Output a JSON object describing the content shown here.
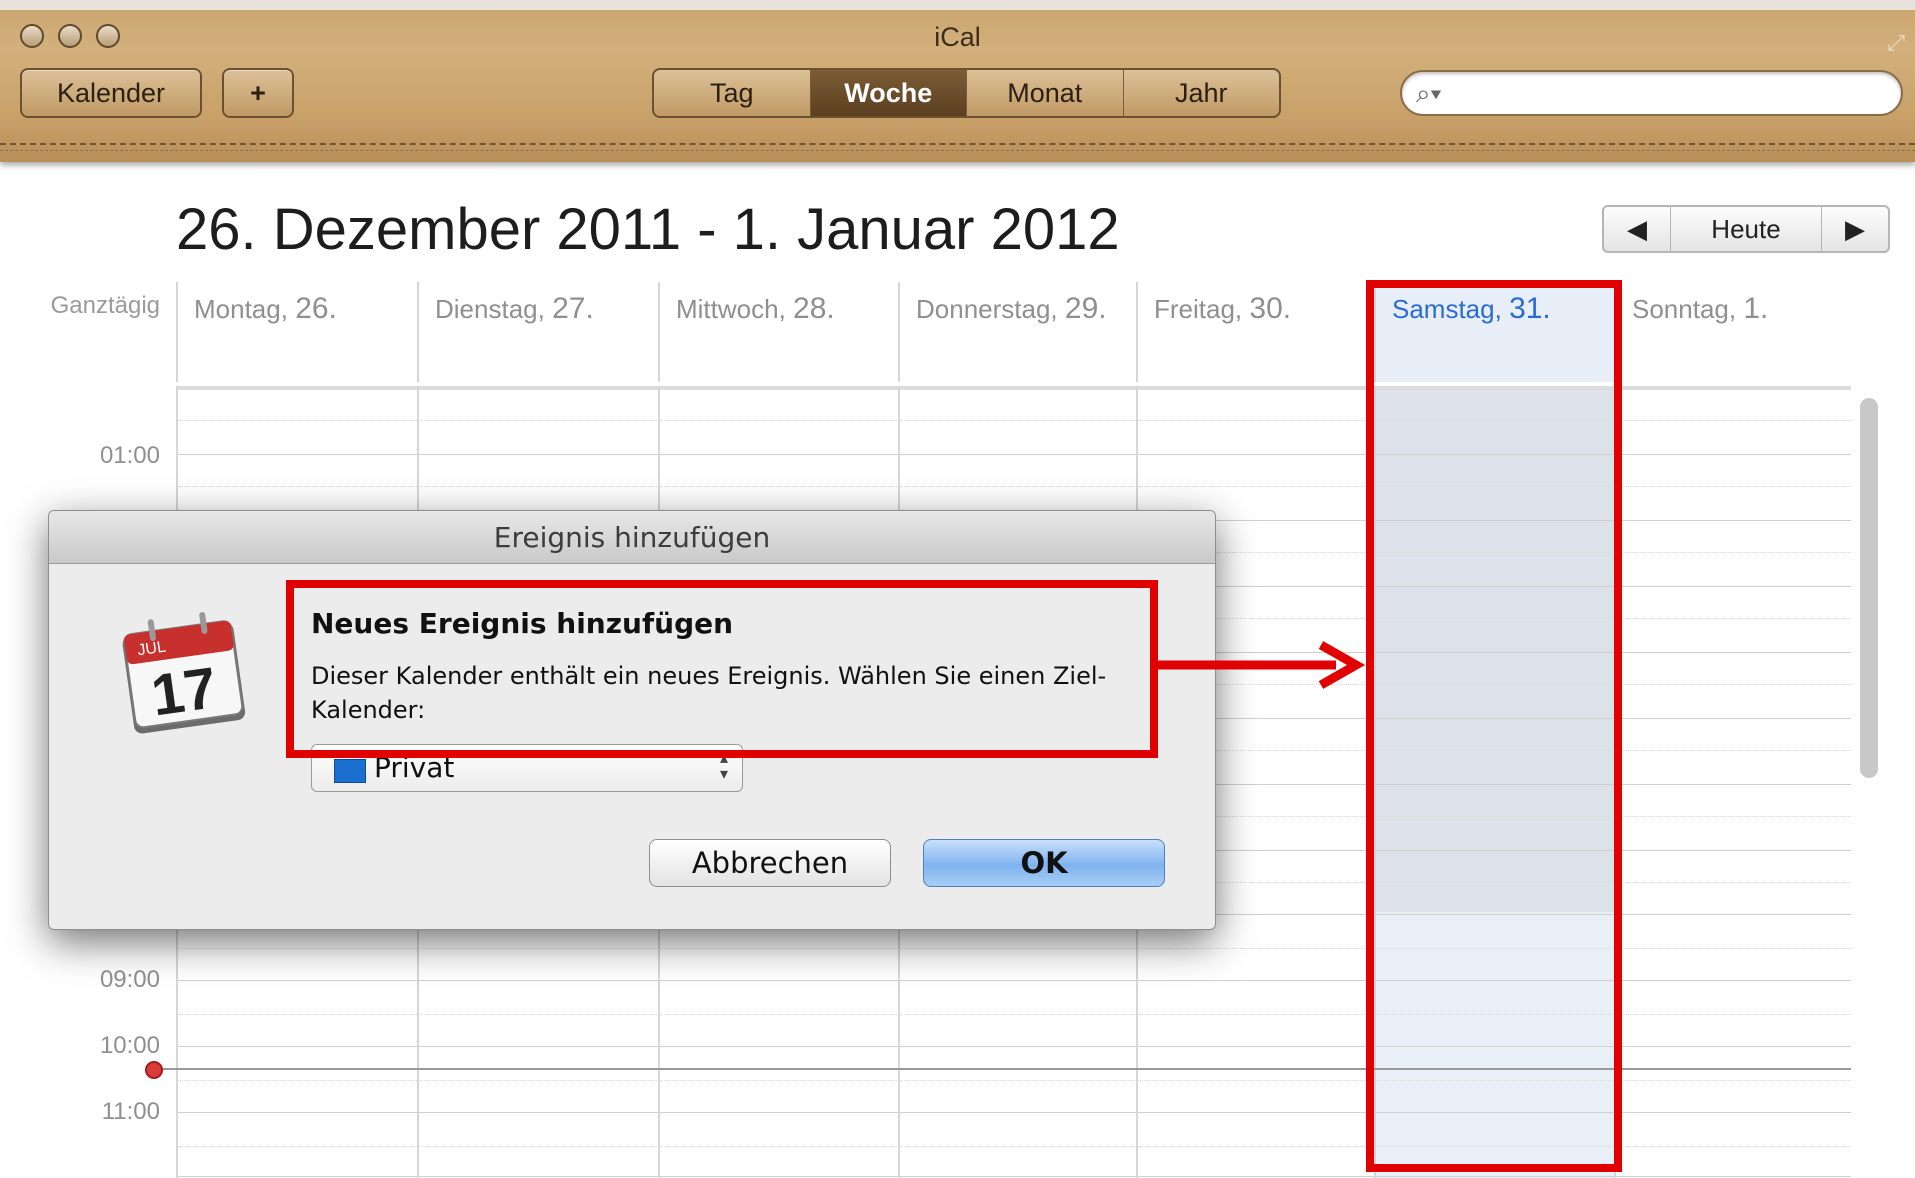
{
  "window": {
    "title": "iCal",
    "resize_icon": "resize-icon"
  },
  "toolbar": {
    "calendars_label": "Kalender",
    "add_label": "+",
    "views": [
      {
        "label": "Tag",
        "active": false
      },
      {
        "label": "Woche",
        "active": true
      },
      {
        "label": "Monat",
        "active": false
      },
      {
        "label": "Jahr",
        "active": false
      }
    ],
    "search": {
      "value": "",
      "placeholder": "",
      "icon": "search-icon"
    }
  },
  "header": {
    "week_range": "26. Dezember 2011 - 1. Januar 2012",
    "nav_prev": "◀",
    "nav_today": "Heute",
    "nav_next": "▶"
  },
  "grid": {
    "allday_label": "Ganztägig",
    "days": [
      {
        "name": "Montag,",
        "num": "26."
      },
      {
        "name": "Dienstag,",
        "num": "27."
      },
      {
        "name": "Mittwoch,",
        "num": "28."
      },
      {
        "name": "Donnerstag,",
        "num": "29."
      },
      {
        "name": "Freitag,",
        "num": "30."
      },
      {
        "name": "Samstag,",
        "num": "31.",
        "today": true
      },
      {
        "name": "Sonntag,",
        "num": "1."
      }
    ],
    "hours": [
      "01:00",
      "09:00",
      "10:00",
      "11:00"
    ],
    "today_color": "#2a6bd6"
  },
  "dialog": {
    "title": "Ereignis hinzufügen",
    "heading": "Neues Ereignis hinzufügen",
    "message": "Dieser Kalender enthält ein neues Ereignis. Wählen Sie einen Ziel-Kalender:",
    "icon_label_month": "JUL",
    "icon_label_day": "17",
    "calendar_select": {
      "value": "Privat",
      "color": "#1a6fd0"
    },
    "cancel_label": "Abbrechen",
    "ok_label": "OK"
  },
  "annotations": {
    "color": "#e00000"
  }
}
